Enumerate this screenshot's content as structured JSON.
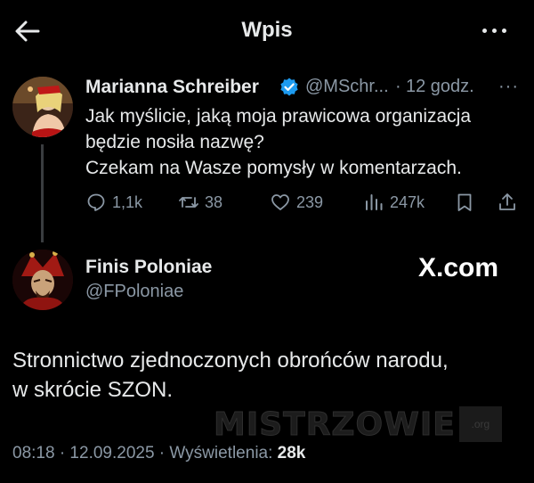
{
  "header": {
    "title": "Wpis"
  },
  "tweet_main": {
    "author_name": "Marianna Schreiber",
    "handle": "@MSchr...",
    "separator": "·",
    "time": "12 godz.",
    "more": "···",
    "text_lines": [
      "Jak myślicie, jaką moja prawicowa organizacja",
      "będzie nosiła nazwę?",
      "Czekam na Wasze pomysły w komentarzach."
    ],
    "actions": {
      "replies": "1,1k",
      "reposts": "38",
      "likes": "239",
      "views": "247k"
    }
  },
  "tweet_reply": {
    "author_name": "Finis Poloniae",
    "handle": "@FPoloniae",
    "source_badge": "X.com",
    "text_lines": [
      "Stronnictwo zjednoczonych obrońców narodu,",
      "w skrócie SZON."
    ],
    "timestamp": "08:18 · 12.09.2025 · Wyświetlenia: ",
    "views_count": "28k"
  },
  "watermark": {
    "text": "MISTRZOWIE",
    "badge": ".org"
  },
  "colors": {
    "background": "#000000",
    "text": "#e7e9ea",
    "muted": "#8b98a5",
    "verified": "#1d9bf0"
  },
  "icons": {
    "back": "arrow-left-icon",
    "more": "more-horizontal-icon",
    "verified": "verified-badge-icon",
    "reply": "reply-icon",
    "repost": "repost-icon",
    "like": "heart-icon",
    "views": "views-icon",
    "bookmark": "bookmark-icon",
    "share": "share-icon"
  }
}
